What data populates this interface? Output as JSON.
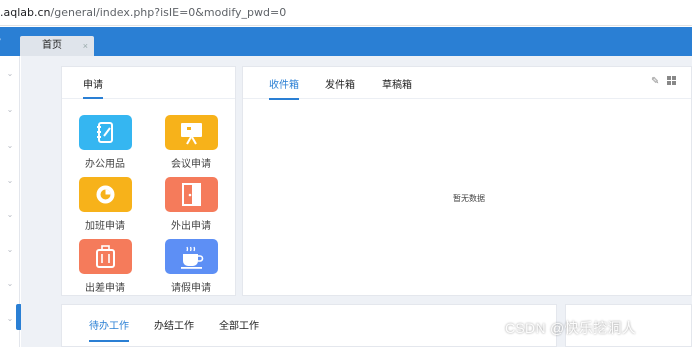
{
  "browser": {
    "url_prefix": ".aqlab.cn",
    "url_path": "/general/index.php?isIE=0&modify_pwd=0"
  },
  "tabs": [
    {
      "label": "首页",
      "close": "×"
    }
  ],
  "apply_panel": {
    "title": "申请",
    "apps": [
      {
        "label": "办公用品",
        "icon": "notebook-icon",
        "color": "#35b6f1"
      },
      {
        "label": "会议申请",
        "icon": "presentation-board-icon",
        "color": "#f7b21a"
      },
      {
        "label": "加班申请",
        "icon": "clock-icon",
        "color": "#f7b21a"
      },
      {
        "label": "外出申请",
        "icon": "door-exit-icon",
        "color": "#f57b5b"
      },
      {
        "label": "出差申请",
        "icon": "suitcase-icon",
        "color": "#f57b5b"
      },
      {
        "label": "请假申请",
        "icon": "coffee-cup-icon",
        "color": "#5d8ff5"
      }
    ]
  },
  "mail_panel": {
    "tabs": [
      "收件箱",
      "发件箱",
      "草稿箱"
    ],
    "active_tab": 0,
    "empty_text": "暂无数据"
  },
  "work_panel": {
    "tabs": [
      "待办工作",
      "办结工作",
      "全部工作"
    ],
    "active_tab": 0
  },
  "watermark": "CSDN @快乐挖洞人",
  "colors": {
    "accent": "#2a7fd4",
    "background": "#eef1f6"
  }
}
